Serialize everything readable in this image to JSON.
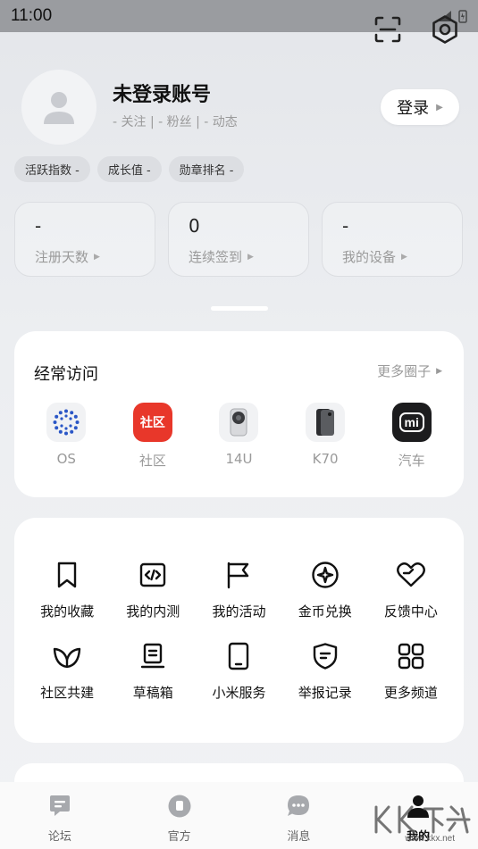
{
  "status_bar": {
    "time": "11:00"
  },
  "top_actions": {
    "scan_icon": "scan-icon",
    "settings_icon": "settings-icon"
  },
  "profile": {
    "name": "未登录账号",
    "stats": "- 关注 | - 粉丝 | - 动态",
    "login_label": "登录"
  },
  "chips": [
    "活跃指数 -",
    "成长值 -",
    "勋章排名 -"
  ],
  "stat_cards": [
    {
      "value": "-",
      "label": "注册天数"
    },
    {
      "value": "0",
      "label": "连续签到"
    },
    {
      "value": "-",
      "label": "我的设备"
    }
  ],
  "frequent": {
    "title": "经常访问",
    "more": "更多圈子",
    "items": [
      {
        "label": "OS",
        "icon": "os-logo"
      },
      {
        "label": "社区",
        "icon": "community-logo",
        "icon_text": "社区",
        "color": "#e8372a"
      },
      {
        "label": "14U",
        "icon": "phone-14u-image"
      },
      {
        "label": "K70",
        "icon": "phone-k70-image"
      },
      {
        "label": "汽车",
        "icon": "mi-logo",
        "icon_text": "mi"
      }
    ]
  },
  "services": {
    "items": [
      {
        "label": "我的收藏",
        "icon": "bookmark-icon"
      },
      {
        "label": "我的内测",
        "icon": "code-icon"
      },
      {
        "label": "我的活动",
        "icon": "flag-icon"
      },
      {
        "label": "金币兑换",
        "icon": "coin-icon"
      },
      {
        "label": "反馈中心",
        "icon": "heart-icon"
      },
      {
        "label": "社区共建",
        "icon": "leaf-icon"
      },
      {
        "label": "草稿箱",
        "icon": "draft-icon"
      },
      {
        "label": "小米服务",
        "icon": "tablet-icon"
      },
      {
        "label": "举报记录",
        "icon": "shield-icon"
      },
      {
        "label": "更多频道",
        "icon": "grid-icon"
      }
    ]
  },
  "tabbar": [
    {
      "label": "论坛",
      "icon": "forum-icon",
      "active": false
    },
    {
      "label": "官方",
      "icon": "official-icon",
      "active": false
    },
    {
      "label": "消息",
      "icon": "message-icon",
      "active": false
    },
    {
      "label": "我的",
      "icon": "profile-icon",
      "active": true
    }
  ],
  "watermark": {
    "text": "www.kkx.net"
  },
  "colors": {
    "accent_red": "#e8372a",
    "text_muted": "#9a9a9a"
  }
}
